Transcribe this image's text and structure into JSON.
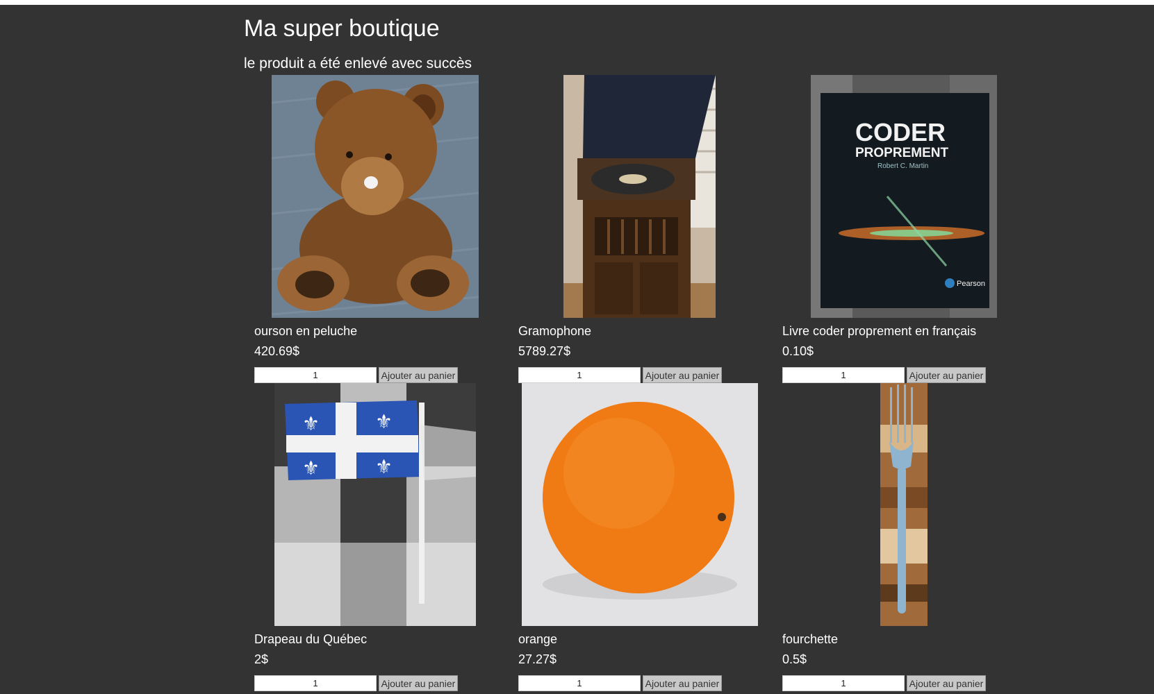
{
  "header": {
    "title": "Ma super boutique",
    "message": "le produit a été enlevé avec succès"
  },
  "products": [
    {
      "name": "ourson en peluche",
      "price": "420.69$",
      "quantity": "1",
      "button_label": "Ajouter au panier",
      "image": "teddy-bear"
    },
    {
      "name": "Gramophone",
      "price": "5789.27$",
      "quantity": "1",
      "button_label": "Ajouter au panier",
      "image": "gramophone"
    },
    {
      "name": "Livre coder proprement en français",
      "price": "0.10$",
      "quantity": "1",
      "button_label": "Ajouter au panier",
      "image": "book-cover",
      "cover": {
        "title_line1": "CODER",
        "title_line2": "PROPREMENT",
        "author": "Robert C. Martin",
        "publisher": "Pearson"
      }
    },
    {
      "name": "Drapeau du Québec",
      "price": "2$",
      "quantity": "1",
      "button_label": "Ajouter au panier",
      "image": "quebec-flag"
    },
    {
      "name": "orange",
      "price": "27.27$",
      "quantity": "1",
      "button_label": "Ajouter au panier",
      "image": "orange"
    },
    {
      "name": "fourchette",
      "price": "0.5$",
      "quantity": "1",
      "button_label": "Ajouter au panier",
      "image": "fork"
    }
  ],
  "colors": {
    "page_background": "#333333",
    "text": "#ffffff",
    "button_background": "#c8c8c8"
  }
}
